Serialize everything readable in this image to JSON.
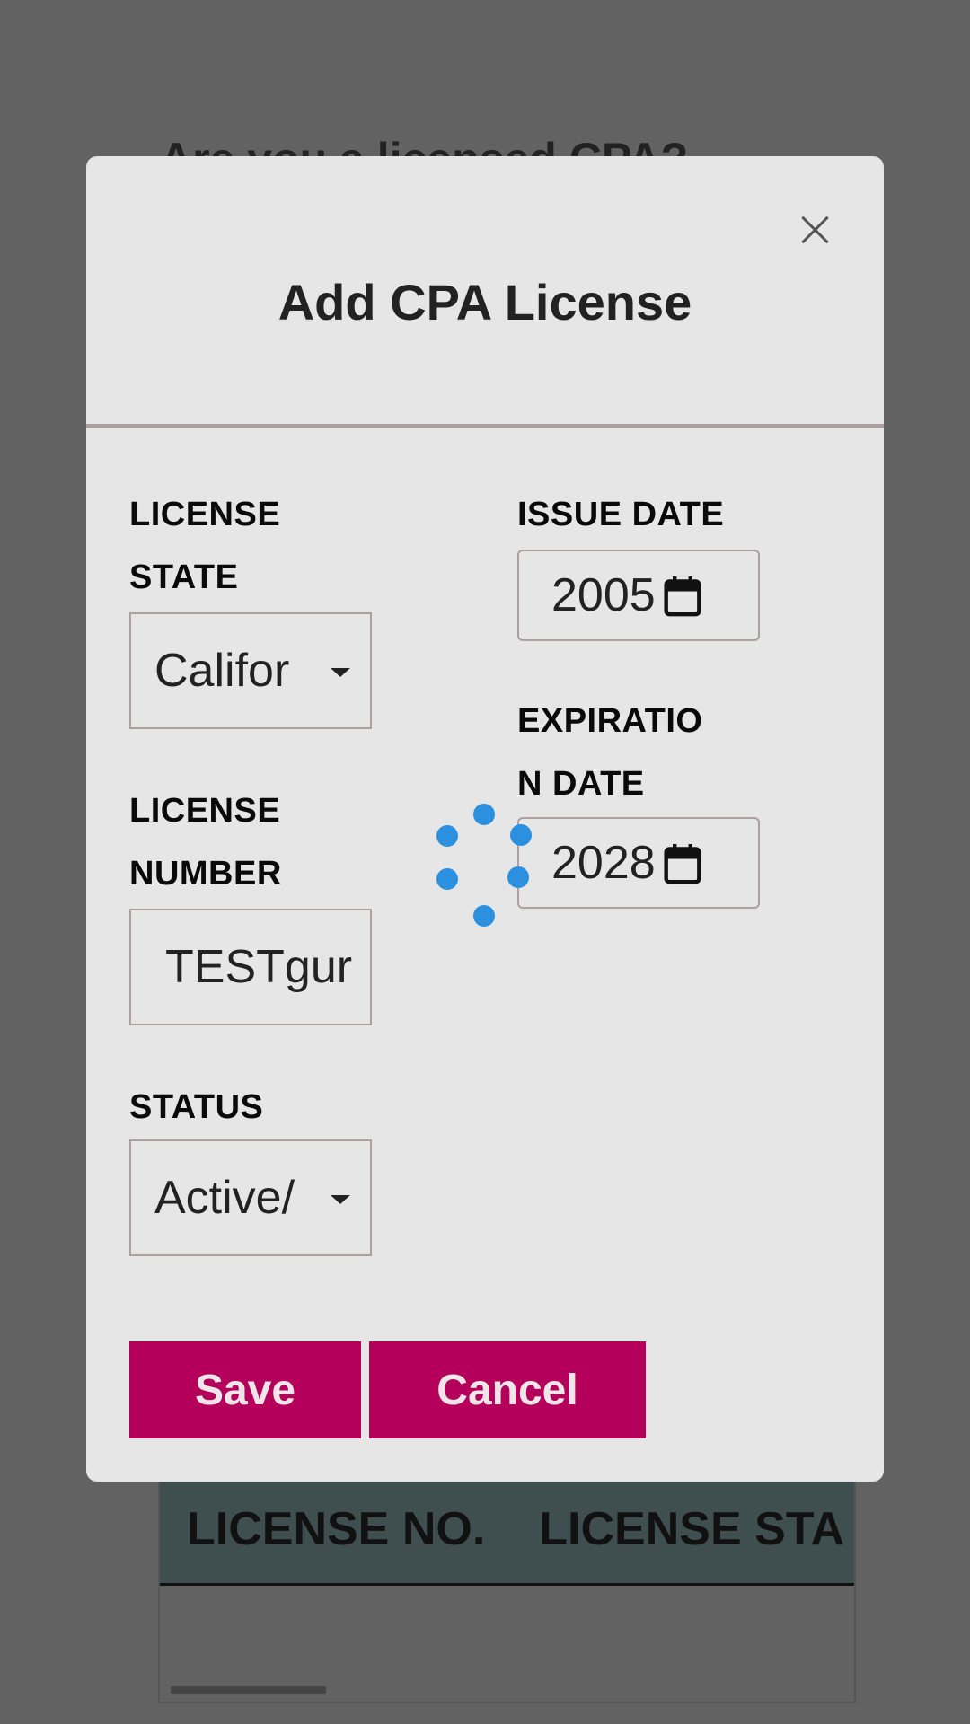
{
  "background": {
    "heading": "Are you a licensed CPA?",
    "table_headers": [
      "LICENSE NO.",
      "LICENSE STA"
    ]
  },
  "modal": {
    "title": "Add CPA License",
    "close_icon": "close-icon",
    "license_state": {
      "label_line1": "LICENSE",
      "label_line2": "STATE",
      "value": "Califor"
    },
    "license_number": {
      "label_line1": "LICENSE",
      "label_line2": "NUMBER",
      "value": "TESTgur"
    },
    "status": {
      "label": "STATUS",
      "value": "Active/"
    },
    "issue_date": {
      "label": "ISSUE DATE",
      "value": "2005"
    },
    "expiration_date": {
      "label_line1": "EXPIRATIO",
      "label_line2": "N DATE",
      "value": "2028"
    },
    "save_label": "Save",
    "cancel_label": "Cancel"
  },
  "colors": {
    "accent": "#b5005b",
    "spinner": "#2b90e0",
    "modal_bg": "#e6e6e7",
    "overlay": "#626262"
  }
}
